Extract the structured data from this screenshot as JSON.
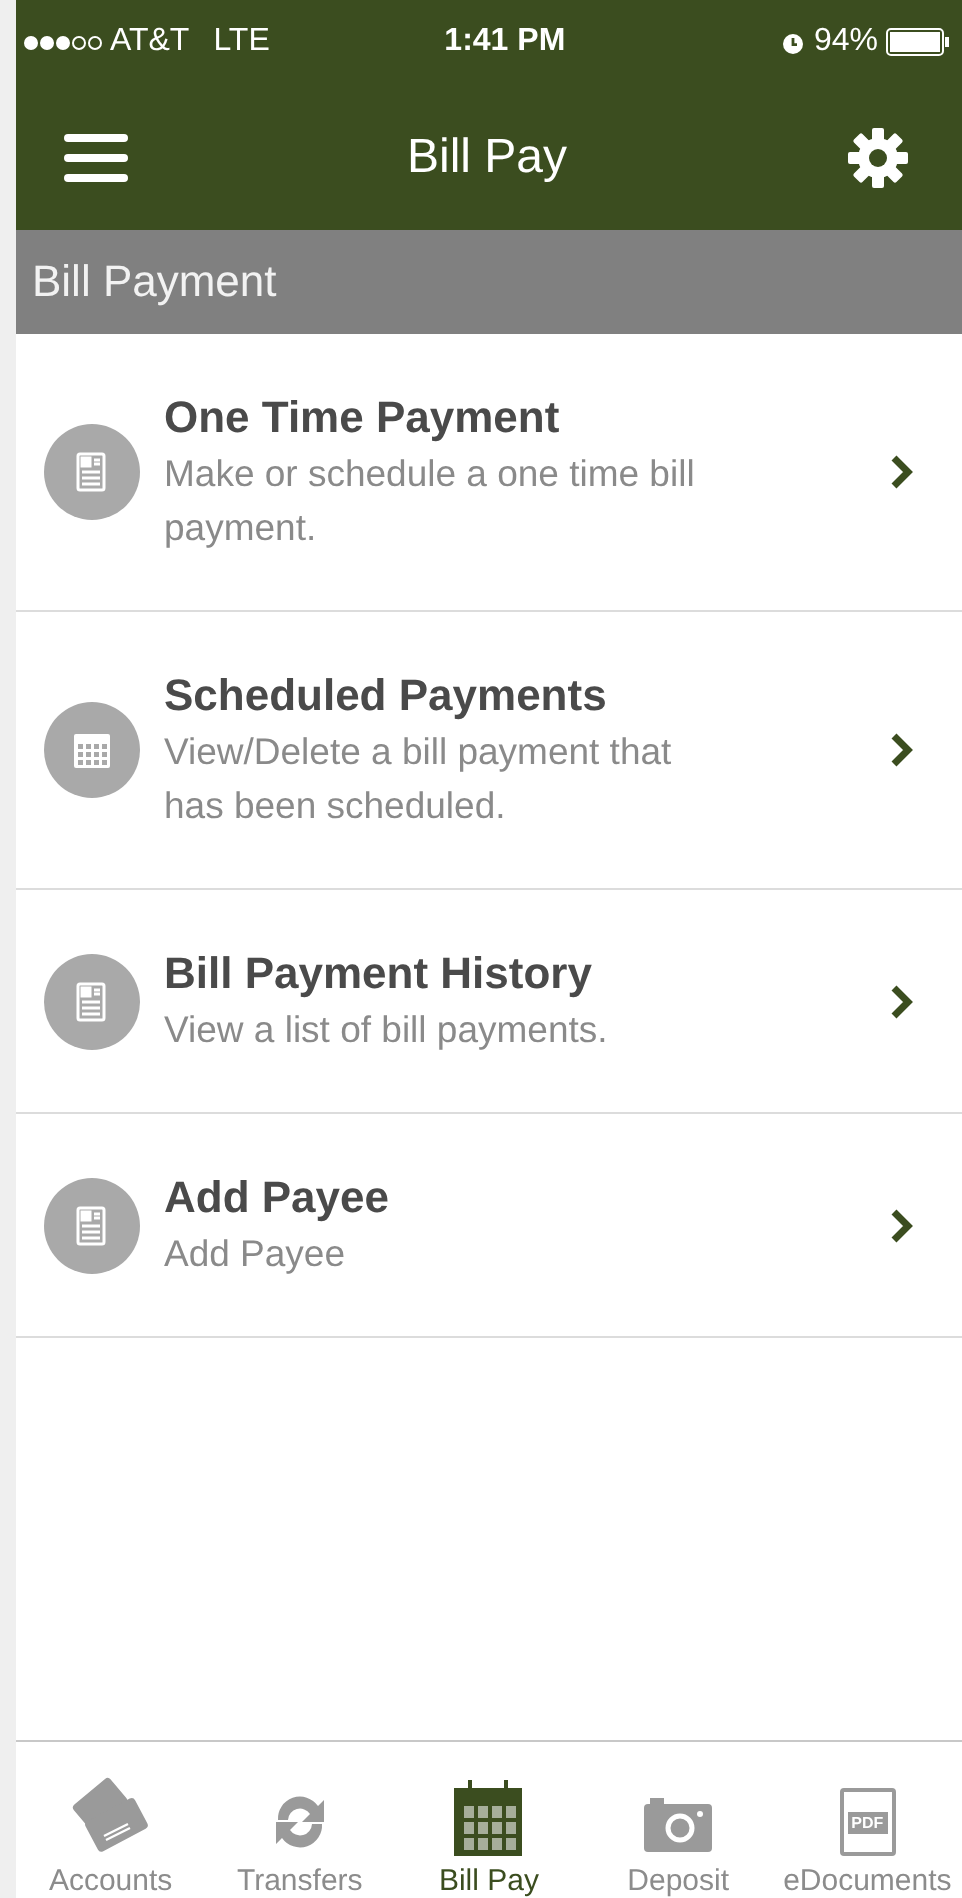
{
  "status_bar": {
    "carrier": "AT&T",
    "network": "LTE",
    "time": "1:41 PM",
    "battery": "94%"
  },
  "header": {
    "title": "Bill Pay"
  },
  "section": {
    "title": "Bill Payment"
  },
  "items": [
    {
      "kind": "document",
      "title": "One Time Payment",
      "description": "Make or schedule a one time bill payment."
    },
    {
      "kind": "calendar",
      "title": "Scheduled Payments",
      "description": "View/Delete a bill payment that has been scheduled."
    },
    {
      "kind": "document",
      "title": "Bill Payment History",
      "description": "View a list of bill payments."
    },
    {
      "kind": "document",
      "title": "Add Payee",
      "description": "Add Payee"
    }
  ],
  "tabs": [
    {
      "kind": "cards",
      "label": "Accounts",
      "selected": false
    },
    {
      "kind": "transfer",
      "label": "Transfers",
      "selected": false
    },
    {
      "kind": "calendar",
      "label": "Bill Pay",
      "selected": true
    },
    {
      "kind": "camera",
      "label": "Deposit",
      "selected": false
    },
    {
      "kind": "pdf",
      "label": "eDocuments",
      "icon_text": "PDF",
      "selected": false
    }
  ]
}
